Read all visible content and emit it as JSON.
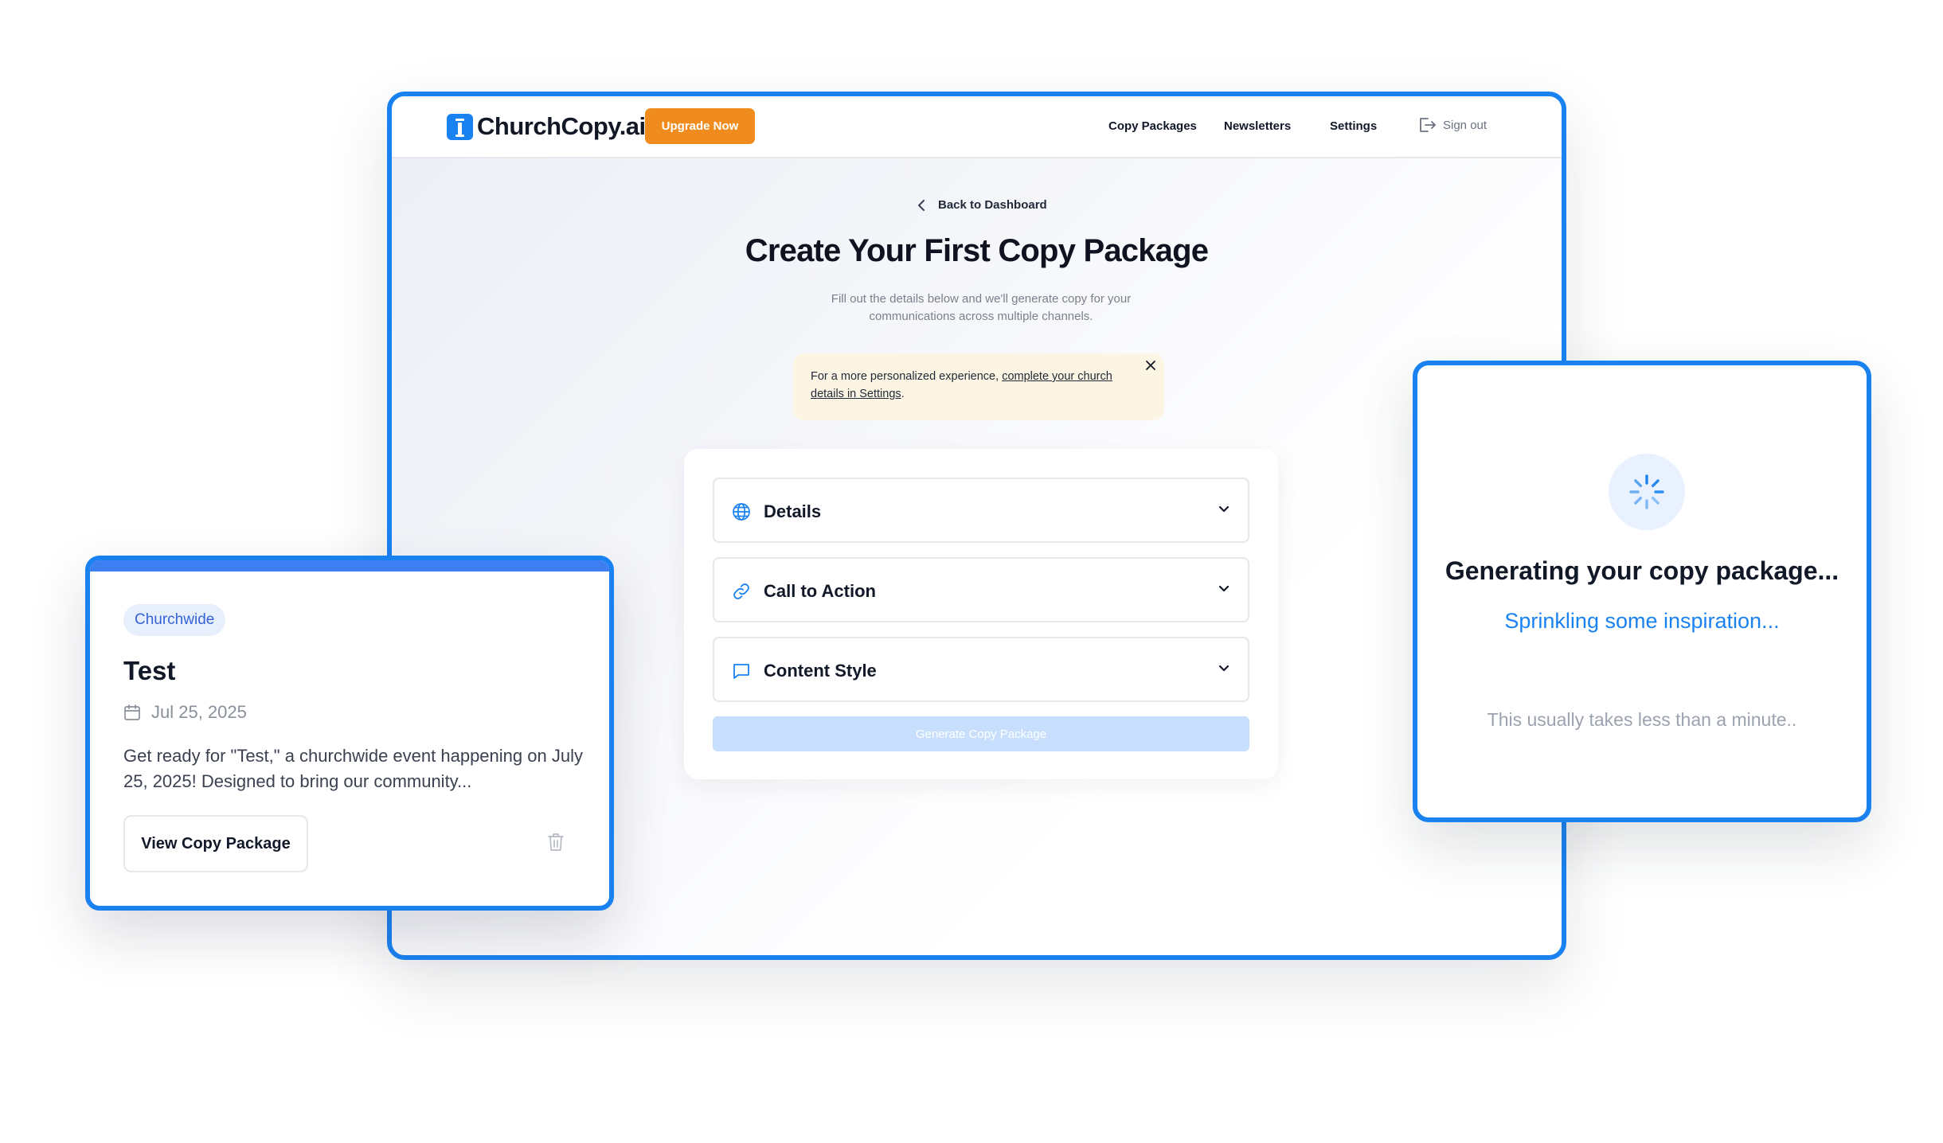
{
  "navbar": {
    "logo_text": "ChurchCopy.ai",
    "upgrade_label": "Upgrade Now",
    "links": [
      "Copy Packages",
      "Newsletters",
      "Settings"
    ],
    "signout_label": "Sign out"
  },
  "page": {
    "back_label": "Back to Dashboard",
    "title": "Create Your First Copy Package",
    "subtitle": "Fill out the details below and we'll generate copy for your communications across multiple channels.",
    "notice_prefix": "For a more personalized experience, ",
    "notice_link": "complete your church details in Settings",
    "notice_suffix": "."
  },
  "form": {
    "sections": [
      {
        "label": "Details",
        "icon": "globe-icon"
      },
      {
        "label": "Call to Action",
        "icon": "link-icon"
      },
      {
        "label": "Content Style",
        "icon": "chat-icon"
      }
    ],
    "generate_label": "Generate Copy Package"
  },
  "event_card": {
    "badge": "Churchwide",
    "title": "Test",
    "date": "Jul 25, 2025",
    "description": "Get ready for \"Test,\" a churchwide event happening on July 25, 2025! Designed to bring our community...",
    "view_label": "View Copy Package"
  },
  "generating_card": {
    "title": "Generating your copy package...",
    "subtitle": "Sprinkling some inspiration...",
    "note": "This usually takes less than a minute.."
  },
  "colors": {
    "accent": "#1a82f0",
    "upgrade": "#f08c1e",
    "notice_bg": "#fdf5e4",
    "badge_bg": "#e8effc",
    "generate_disabled": "#c7dffc"
  }
}
